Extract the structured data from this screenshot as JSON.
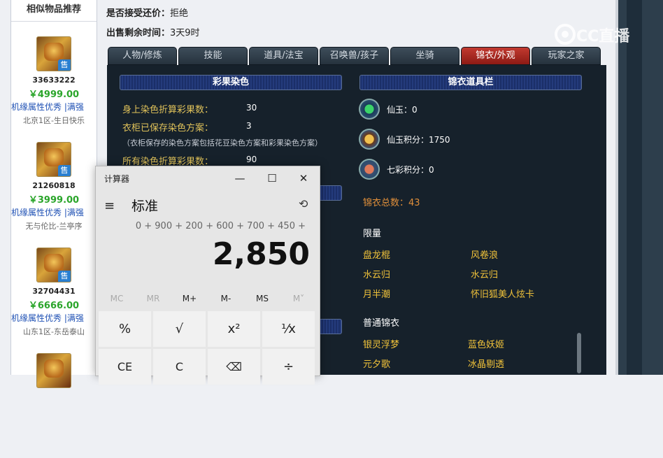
{
  "sidebar": {
    "title": "相似物品推荐",
    "cards": [
      {
        "id": "33633222",
        "price": "￥4999.00",
        "desc": "机缘属性优秀 |满强",
        "server": "北京1区-生日快乐",
        "badge": "售"
      },
      {
        "id": "21260818",
        "price": "￥3999.00",
        "desc": "机缘属性优秀 |满强",
        "server": "无与伦比-兰亭序",
        "badge": "售"
      },
      {
        "id": "32704431",
        "price": "￥6666.00",
        "desc": "机缘属性优秀 |满强",
        "server": "山东1区-东岳泰山",
        "badge": "售"
      }
    ]
  },
  "info": {
    "bargain_label": "是否接受还价：",
    "bargain_value": "拒绝",
    "time_label": "出售剩余时间：",
    "time_value": "3天9时"
  },
  "tabs": [
    "人物/修炼",
    "技能",
    "道具/法宝",
    "召唤兽/孩子",
    "坐骑",
    "锦衣/外观",
    "玩家之家"
  ],
  "active_tab": "锦衣/外观",
  "game": {
    "left_bar": "彩果染色",
    "right_bar": "锦衣道具栏",
    "rows": [
      {
        "label": "身上染色折算彩果数：",
        "value": "30"
      },
      {
        "label": "衣柜已保存染色方案：",
        "value": "3"
      },
      {
        "label": "所有染色折算彩果数：",
        "value": "90"
      }
    ],
    "note": "（衣柜保存的染色方案包括花豆染色方案和彩果染色方案）",
    "coins": [
      {
        "label": "仙玉：0",
        "icon": "jade-icon",
        "color": "#2fa84a"
      },
      {
        "label": "仙玉积分：1750",
        "icon": "jade-points-icon",
        "color": "#d9a43a"
      },
      {
        "label": "七彩积分：0",
        "icon": "rainbow-points-icon",
        "color": "#d86a4a"
      }
    ],
    "total": "锦衣总数：43",
    "limited_title": "限量",
    "limited_items": [
      [
        "盘龙棍",
        "风卷浪"
      ],
      [
        "水云归",
        "水云归"
      ],
      [
        "月半潮",
        "怀旧狐美人炫卡"
      ]
    ],
    "normal_title": "普通锦衣",
    "normal_items": [
      [
        "银灵浮梦",
        "蓝色妖姬"
      ],
      [
        "元夕歌",
        "冰晶剔透"
      ]
    ]
  },
  "watermark": "CC直播",
  "calculator": {
    "title": "计算器",
    "mode": "标准",
    "expression": "0 + 900 + 200 + 600 + 700 + 450 +",
    "display": "2,850",
    "memory": [
      "MC",
      "MR",
      "M+",
      "M-",
      "MS",
      "M˅"
    ],
    "row1": [
      "%",
      "√",
      "x²",
      "¹⁄x"
    ],
    "row2": [
      "CE",
      "C",
      "⌫",
      "÷"
    ],
    "window_buttons": [
      "—",
      "☐",
      "✕"
    ]
  },
  "colors": {
    "active_tab": "#b02a22",
    "panel": "#16212b",
    "gold": "#f0c23a",
    "price": "#2aa52a"
  }
}
